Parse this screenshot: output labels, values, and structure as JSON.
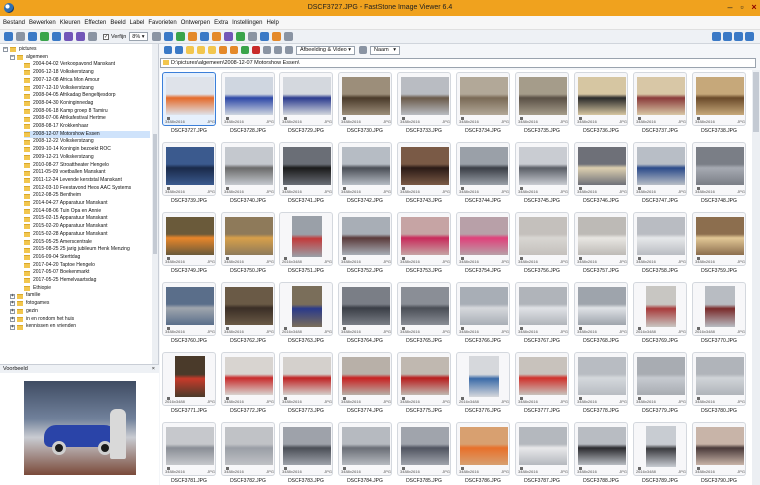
{
  "window": {
    "title": "DSCF3727.JPG - FastStone Image Viewer 6.4"
  },
  "menu": [
    "Bestand",
    "Bewerken",
    "Kleuren",
    "Effecten",
    "Beeld",
    "Label",
    "Favorieten",
    "Ontwerpen",
    "Extra",
    "Instellingen",
    "Help"
  ],
  "toolbar": {
    "verfijn_label": "Verfijn",
    "zoom_value": "8%",
    "sort_value": "Naam",
    "filter_value": "Afbeelding & Video"
  },
  "tree": {
    "root": "pictures",
    "group": "algemeen",
    "items": [
      "2004-04-02 Verkoopavond Manskant",
      "2006-12-18 Volkskerstzang",
      "2007-12-08 Africa Mon Amour",
      "2007-12-10 Volkskerstzang",
      "2008-04-05 Afrikadag Bengeltjesdorp",
      "2008-04-30 Koninginnedag",
      "2008-06-18 Kamp groep 8 Tamiru",
      "2008-07-06 Afrikafestival Hertme",
      "2008-08-17 Krokkenhaar",
      "2008-12-07 Motorshow Essen",
      "2008-12-22 Volkskerstzang",
      "2009-10-14 Koningin bezoekt ROC",
      "2009-12-21 Volkskerstzang",
      "2010-08-27 Stroattheater Hengelo",
      "2011-05-09 voetballen Manskant",
      "2011-12-24 Levende kerststal Manskant",
      "2012-03-10 Feestavond Heos AAC Systems",
      "2012-08-25 Bentheim",
      "2014-04-27 Apparatuur Manskant",
      "2014-08-06 Tuin Opa en Annie",
      "2015-02-15 Apparatuur Manskant",
      "2015-02-20 Apparatuur Manskant",
      "2015-02-28 Apparatuur Manskant",
      "2015-05-25 Amerscentrale",
      "2015-08-25 25 jarig jubileum Henk Menzing",
      "2016-09-04 Sterttdag",
      "2017-04-20 Taptoe Hengelo",
      "2017-05-07 Boekenmarkt",
      "2017-05-25 Hemelvaartsdag",
      "Ethiopie"
    ],
    "selected_index": 9,
    "other_groups": [
      "familie",
      "fotogames",
      "gezin",
      "in en rondom het huis",
      "kennissen en vrienden"
    ]
  },
  "preview": {
    "label": "Voorbeeld"
  },
  "path": "D:\\pictures\\algemeen\\2008-12-07 Motorshow Essen\\",
  "thumbnails": [
    {
      "name": "DSCF3727.JPG",
      "dims": "3488x2616",
      "type": "JPG",
      "orient": "landscape",
      "colors": [
        "#dfe3ea",
        "#e46a2a"
      ]
    },
    {
      "name": "DSCF3728.JPG",
      "dims": "3488x2616",
      "type": "JPG",
      "orient": "landscape",
      "colors": [
        "#cfd6e0",
        "#2c47a7"
      ]
    },
    {
      "name": "DSCF3729.JPG",
      "dims": "3488x2616",
      "type": "JPG",
      "orient": "landscape",
      "colors": [
        "#d4d8de",
        "#2a3a8e"
      ]
    },
    {
      "name": "DSCF3730.JPG",
      "dims": "3488x2616",
      "type": "JPG",
      "orient": "landscape",
      "colors": [
        "#9c8e7a",
        "#4a3a2a"
      ]
    },
    {
      "name": "DSCF3733.JPG",
      "dims": "3488x2616",
      "type": "JPG",
      "orient": "landscape",
      "colors": [
        "#b9bcc2",
        "#6a5a4a"
      ]
    },
    {
      "name": "DSCF3734.JPG",
      "dims": "3488x2616",
      "type": "JPG",
      "orient": "landscape",
      "colors": [
        "#b2a898",
        "#7a6a56"
      ]
    },
    {
      "name": "DSCF3735.JPG",
      "dims": "3488x2616",
      "type": "JPG",
      "orient": "landscape",
      "colors": [
        "#a59c8a",
        "#5a5046"
      ]
    },
    {
      "name": "DSCF3736.JPG",
      "dims": "3488x2616",
      "type": "JPG",
      "orient": "landscape",
      "colors": [
        "#d6c6a2",
        "#2a2a2a"
      ]
    },
    {
      "name": "DSCF3737.JPG",
      "dims": "3488x2616",
      "type": "JPG",
      "orient": "landscape",
      "colors": [
        "#d8c7a6",
        "#8a3a3a"
      ]
    },
    {
      "name": "DSCF3738.JPG",
      "dims": "3488x2616",
      "type": "JPG",
      "orient": "landscape",
      "colors": [
        "#c6a87a",
        "#6a4a2a"
      ]
    },
    {
      "name": "DSCF3739.JPG",
      "dims": "3488x2616",
      "type": "JPG",
      "orient": "landscape",
      "colors": [
        "#3b5a8e",
        "#1a2a4a"
      ]
    },
    {
      "name": "DSCF3740.JPG",
      "dims": "3488x2616",
      "type": "JPG",
      "orient": "landscape",
      "colors": [
        "#c4c8ce",
        "#6a6a6a"
      ]
    },
    {
      "name": "DSCF3741.JPG",
      "dims": "3488x2616",
      "type": "JPG",
      "orient": "landscape",
      "colors": [
        "#6a6e76",
        "#1a1a1a"
      ]
    },
    {
      "name": "DSCF3742.JPG",
      "dims": "3488x2616",
      "type": "JPG",
      "orient": "landscape",
      "colors": [
        "#b6bcc4",
        "#4a4e56"
      ]
    },
    {
      "name": "DSCF3743.JPG",
      "dims": "3488x2616",
      "type": "JPG",
      "orient": "landscape",
      "colors": [
        "#7a5a46",
        "#2a1a16"
      ]
    },
    {
      "name": "DSCF3744.JPG",
      "dims": "3488x2616",
      "type": "JPG",
      "orient": "landscape",
      "colors": [
        "#9aa0a8",
        "#3a3e46"
      ]
    },
    {
      "name": "DSCF3745.JPG",
      "dims": "3488x2616",
      "type": "JPG",
      "orient": "landscape",
      "colors": [
        "#c9ccd2",
        "#5a5e66"
      ]
    },
    {
      "name": "DSCF3746.JPG",
      "dims": "3488x2616",
      "type": "JPG",
      "orient": "landscape",
      "colors": [
        "#6e7078",
        "#ddd0b0"
      ]
    },
    {
      "name": "DSCF3747.JPG",
      "dims": "3488x2616",
      "type": "JPG",
      "orient": "landscape",
      "colors": [
        "#b8bec6",
        "#2a4a8a"
      ]
    },
    {
      "name": "DSCF3748.JPG",
      "dims": "3488x2616",
      "type": "JPG",
      "orient": "landscape",
      "colors": [
        "#7a7e86",
        "#a6aab2"
      ]
    },
    {
      "name": "DSCF3749.JPG",
      "dims": "3488x2616",
      "type": "JPG",
      "orient": "landscape",
      "colors": [
        "#6a5a3a",
        "#e8862a"
      ]
    },
    {
      "name": "DSCF3750.JPG",
      "dims": "3488x2616",
      "type": "JPG",
      "orient": "landscape",
      "colors": [
        "#8e7a5a",
        "#d8a04a"
      ]
    },
    {
      "name": "DSCF3751.JPG",
      "dims": "2616x3488",
      "type": "JPG",
      "orient": "portrait",
      "colors": [
        "#9aa0a8",
        "#c23a3a"
      ]
    },
    {
      "name": "DSCF3752.JPG",
      "dims": "3488x2616",
      "type": "JPG",
      "orient": "landscape",
      "colors": [
        "#a8aeb6",
        "#5a3a3a"
      ]
    },
    {
      "name": "DSCF3753.JPG",
      "dims": "3488x2616",
      "type": "JPG",
      "orient": "landscape",
      "colors": [
        "#c6a4a4",
        "#c82a5a"
      ]
    },
    {
      "name": "DSCF3754.JPG",
      "dims": "3488x2616",
      "type": "JPG",
      "orient": "landscape",
      "colors": [
        "#b8a0a8",
        "#e0407a"
      ]
    },
    {
      "name": "DSCF3756.JPG",
      "dims": "3488x2616",
      "type": "JPG",
      "orient": "landscape",
      "colors": [
        "#c4c0bc",
        "#d8d6d2"
      ]
    },
    {
      "name": "DSCF3757.JPG",
      "dims": "3488x2616",
      "type": "JPG",
      "orient": "landscape",
      "colors": [
        "#bdbab6",
        "#e8e6e2"
      ]
    },
    {
      "name": "DSCF3758.JPG",
      "dims": "3488x2616",
      "type": "JPG",
      "orient": "landscape",
      "colors": [
        "#b9bcc2",
        "#e6e8ea"
      ]
    },
    {
      "name": "DSCF3759.JPG",
      "dims": "3488x2616",
      "type": "JPG",
      "orient": "landscape",
      "colors": [
        "#8c6e4e",
        "#e2c896"
      ]
    },
    {
      "name": "DSCF3760.JPG",
      "dims": "3488x2616",
      "type": "JPG",
      "orient": "landscape",
      "colors": [
        "#5a6e8a",
        "#a0a6ae"
      ]
    },
    {
      "name": "DSCF3762.JPG",
      "dims": "3488x2616",
      "type": "JPG",
      "orient": "landscape",
      "colors": [
        "#6a5a46",
        "#3a2e26"
      ]
    },
    {
      "name": "DSCF3763.JPG",
      "dims": "2616x3488",
      "type": "JPG",
      "orient": "portrait",
      "colors": [
        "#7a6e5a",
        "#2a3a8a"
      ]
    },
    {
      "name": "DSCF3764.JPG",
      "dims": "3488x2616",
      "type": "JPG",
      "orient": "landscape",
      "colors": [
        "#7a7e86",
        "#3a3e46"
      ]
    },
    {
      "name": "DSCF3765.JPG",
      "dims": "3488x2616",
      "type": "JPG",
      "orient": "landscape",
      "colors": [
        "#8a8e96",
        "#4a4e56"
      ]
    },
    {
      "name": "DSCF3766.JPG",
      "dims": "3488x2616",
      "type": "JPG",
      "orient": "landscape",
      "colors": [
        "#a8aeb6",
        "#d6d8dc"
      ]
    },
    {
      "name": "DSCF3767.JPG",
      "dims": "3488x2616",
      "type": "JPG",
      "orient": "landscape",
      "colors": [
        "#b0b4ba",
        "#e0e2e6"
      ]
    },
    {
      "name": "DSCF3768.JPG",
      "dims": "3488x2616",
      "type": "JPG",
      "orient": "landscape",
      "colors": [
        "#9ea4ac",
        "#dfe2e6"
      ]
    },
    {
      "name": "DSCF3769.JPG",
      "dims": "2616x3488",
      "type": "JPG",
      "orient": "portrait",
      "colors": [
        "#c8c6c2",
        "#a83a3a"
      ]
    },
    {
      "name": "DSCF3770.JPG",
      "dims": "2616x3488",
      "type": "JPG",
      "orient": "portrait",
      "colors": [
        "#b8bcc2",
        "#7a2a2a"
      ]
    },
    {
      "name": "DSCF3771.JPG",
      "dims": "2616x3488",
      "type": "JPG",
      "orient": "portrait",
      "colors": [
        "#4a3a2a",
        "#c83a2a"
      ]
    },
    {
      "name": "DSCF3772.JPG",
      "dims": "3488x2616",
      "type": "JPG",
      "orient": "landscape",
      "colors": [
        "#d8d4d0",
        "#c82a2a"
      ]
    },
    {
      "name": "DSCF3773.JPG",
      "dims": "3488x2616",
      "type": "JPG",
      "orient": "landscape",
      "colors": [
        "#d4d0cc",
        "#c02222"
      ]
    },
    {
      "name": "DSCF3774.JPG",
      "dims": "3488x2616",
      "type": "JPG",
      "orient": "landscape",
      "colors": [
        "#b8b0a8",
        "#c82020"
      ]
    },
    {
      "name": "DSCF3775.JPG",
      "dims": "3488x2616",
      "type": "JPG",
      "orient": "landscape",
      "colors": [
        "#c0b8b0",
        "#b81c1c"
      ]
    },
    {
      "name": "DSCF3776.JPG",
      "dims": "2616x3488",
      "type": "JPG",
      "orient": "portrait",
      "colors": [
        "#d6d8dc",
        "#3a6aa8"
      ]
    },
    {
      "name": "DSCF3777.JPG",
      "dims": "3488x2616",
      "type": "JPG",
      "orient": "landscape",
      "colors": [
        "#c8c2bc",
        "#d0302a"
      ]
    },
    {
      "name": "DSCF3778.JPG",
      "dims": "3488x2616",
      "type": "JPG",
      "orient": "landscape",
      "colors": [
        "#b8bcc2",
        "#d4d8dc"
      ]
    },
    {
      "name": "DSCF3779.JPG",
      "dims": "3488x2616",
      "type": "JPG",
      "orient": "landscape",
      "colors": [
        "#a8acb2",
        "#c6cad0"
      ]
    },
    {
      "name": "DSCF3780.JPG",
      "dims": "3488x2616",
      "type": "JPG",
      "orient": "landscape",
      "colors": [
        "#b0b4ba",
        "#d0d4d8"
      ]
    },
    {
      "name": "DSCF3781.JPG",
      "dims": "3488x2616",
      "type": "JPG",
      "orient": "landscape",
      "colors": [
        "#c6c8cc",
        "#8a8e96"
      ]
    },
    {
      "name": "DSCF3782.JPG",
      "dims": "3488x2616",
      "type": "JPG",
      "orient": "landscape",
      "colors": [
        "#c0c2c6",
        "#9a9ea6"
      ]
    },
    {
      "name": "DSCF3783.JPG",
      "dims": "3488x2616",
      "type": "JPG",
      "orient": "landscape",
      "colors": [
        "#9ea2aa",
        "#4a4e56"
      ]
    },
    {
      "name": "DSCF3784.JPG",
      "dims": "3488x2616",
      "type": "JPG",
      "orient": "landscape",
      "colors": [
        "#b6bac0",
        "#6a6e76"
      ]
    },
    {
      "name": "DSCF3785.JPG",
      "dims": "3488x2616",
      "type": "JPG",
      "orient": "landscape",
      "colors": [
        "#a0a4ac",
        "#505460"
      ]
    },
    {
      "name": "DSCF3786.JPG",
      "dims": "3488x2616",
      "type": "JPG",
      "orient": "landscape",
      "colors": [
        "#d8a070",
        "#e8702a"
      ]
    },
    {
      "name": "DSCF3787.JPG",
      "dims": "3488x2616",
      "type": "JPG",
      "orient": "landscape",
      "colors": [
        "#b4b8be",
        "#e8e8ea"
      ]
    },
    {
      "name": "DSCF3788.JPG",
      "dims": "3488x2616",
      "type": "JPG",
      "orient": "landscape",
      "colors": [
        "#b8bcc2",
        "#2a2a2e"
      ]
    },
    {
      "name": "DSCF3789.JPG",
      "dims": "2616x3488",
      "type": "JPG",
      "orient": "portrait",
      "colors": [
        "#c8ccd2",
        "#3a3a3e"
      ]
    },
    {
      "name": "DSCF3790.JPG",
      "dims": "3488x2616",
      "type": "JPG",
      "orient": "landscape",
      "colors": [
        "#c8b4a8",
        "#4a3a3a"
      ]
    }
  ]
}
